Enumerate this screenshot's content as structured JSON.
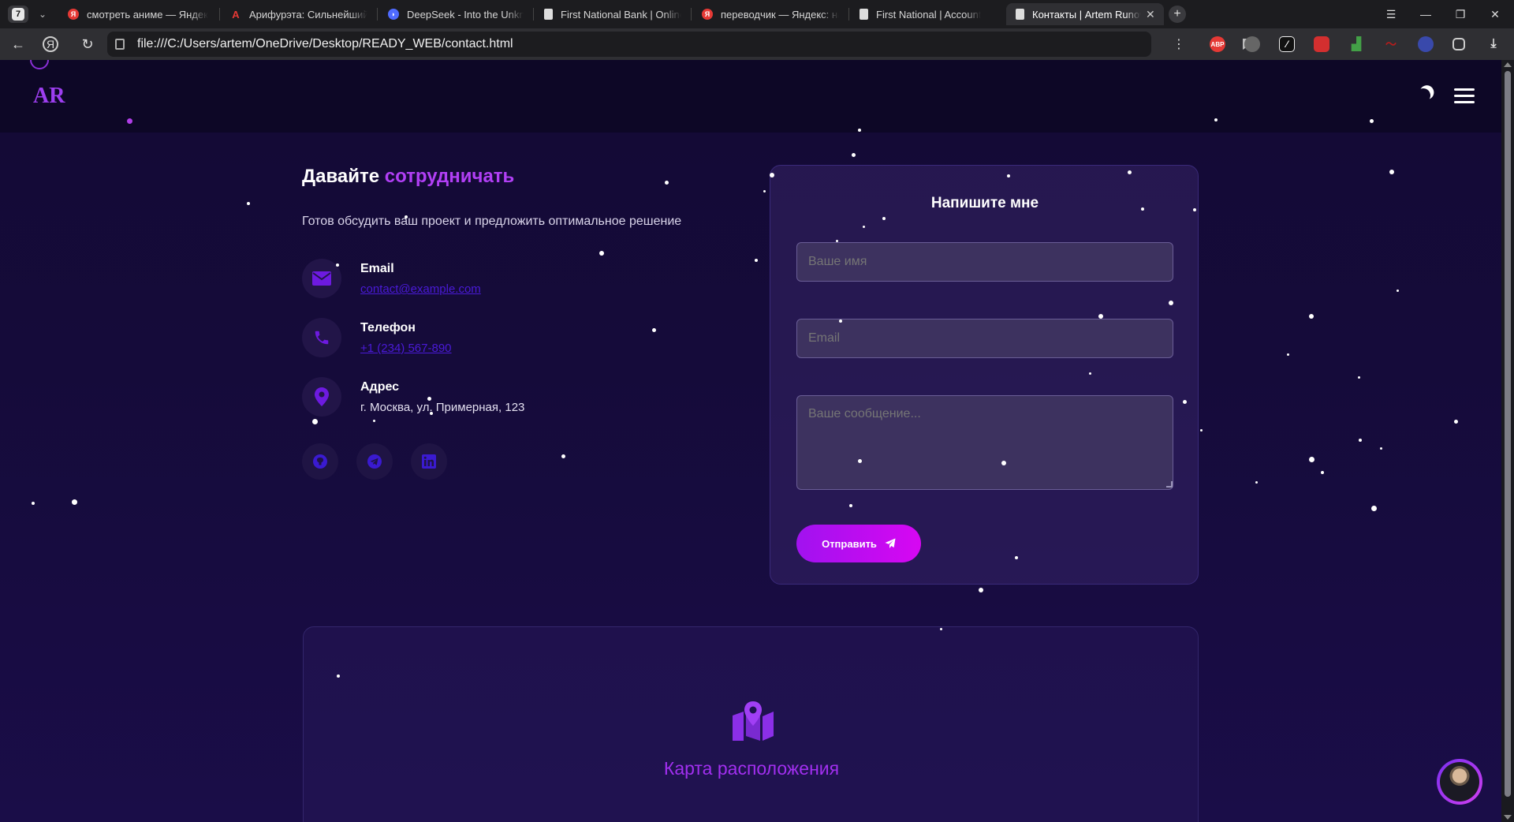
{
  "browser": {
    "tab_count": "7",
    "tabs": [
      {
        "title": "смотреть аниме — Яндекс",
        "favicon": "yandex-icon",
        "color": "#e53935"
      },
      {
        "title": "Арифурэта: Сильнейший",
        "favicon": "a-letter-icon",
        "color": "#e53935"
      },
      {
        "title": "DeepSeek - Into the Unkno",
        "favicon": "deepseek-icon",
        "color": "#4f6bff"
      },
      {
        "title": "First National Bank | Online",
        "favicon": "document-icon",
        "color": "#dddddd"
      },
      {
        "title": "переводчик — Яндекс: на",
        "favicon": "yandex-icon",
        "color": "#e53935"
      },
      {
        "title": "First National | Account",
        "favicon": "document-icon",
        "color": "#dddddd"
      },
      {
        "title": "Контакты | Artem Runov",
        "favicon": "document-icon",
        "color": "#dddddd",
        "active": true
      }
    ],
    "url": "file:///C:/Users/artem/OneDrive/Desktop/READY_WEB/contact.html",
    "extensions": [
      {
        "name": "adblock-icon",
        "label": "ABP",
        "color": "#e53935"
      },
      {
        "name": "extension-gray-icon",
        "label": "",
        "color": "#666666"
      },
      {
        "name": "extension-pen-icon",
        "label": "",
        "color": "#111111"
      },
      {
        "name": "extension-lock-icon",
        "label": "",
        "color": "#d32f2f"
      },
      {
        "name": "extension-chart-icon",
        "label": "",
        "color": "#43a047"
      },
      {
        "name": "extension-wave-icon",
        "label": "",
        "color": "#b71c1c"
      },
      {
        "name": "extension-chat-icon",
        "label": "",
        "color": "#3949ab"
      }
    ]
  },
  "header": {
    "logo": "AR",
    "accent_color": "#9d3ef0"
  },
  "contact": {
    "title_main": "Давайте ",
    "title_accent": "сотрудничать",
    "subtitle": "Готов обсудить ваш проект и предложить оптимальное решение",
    "items": [
      {
        "label": "Email",
        "value": "contact@example.com",
        "icon": "envelope-icon"
      },
      {
        "label": "Телефон",
        "value": "+1 (234) 567-890",
        "icon": "phone-icon"
      },
      {
        "label": "Адрес",
        "value": "г. Москва, ул. Примерная, 123",
        "icon": "map-pin-icon"
      }
    ],
    "socials": [
      "github-icon",
      "telegram-icon",
      "linkedin-icon"
    ]
  },
  "form": {
    "title": "Напишите мне",
    "name_placeholder": "Ваше имя",
    "email_placeholder": "Email",
    "message_placeholder": "Ваше сообщение...",
    "submit_label": "Отправить"
  },
  "map": {
    "label": "Карта расположения"
  }
}
